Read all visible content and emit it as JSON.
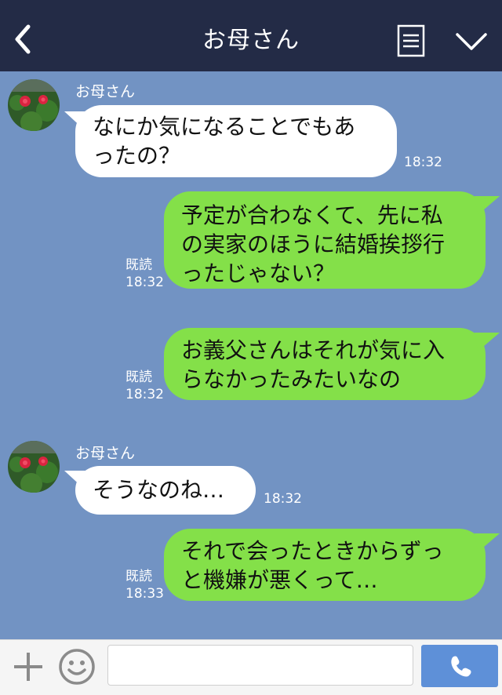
{
  "header": {
    "title": "お母さん"
  },
  "messages": [
    {
      "side": "in",
      "sender": "お母さん",
      "lines": [
        "なにか気になることでもあ",
        "ったの？"
      ],
      "time": "18:32"
    },
    {
      "side": "out",
      "lines": [
        "予定が合わなくて、先に私",
        "の実家のほうに結婚挨拶行",
        "ったじゃない？"
      ],
      "read": "既読",
      "time": "18:32"
    },
    {
      "side": "out",
      "lines": [
        "お義父さんはそれが気に入",
        "らなかったみたいなの"
      ],
      "read": "既読",
      "time": "18:32"
    },
    {
      "side": "in",
      "sender": "お母さん",
      "lines": [
        "そうなのね…"
      ],
      "time": "18:32"
    },
    {
      "side": "out",
      "lines": [
        "それで会ったときからずっ",
        "と機嫌が悪くって…"
      ],
      "read": "既読",
      "time": "18:33"
    }
  ],
  "footer": {
    "input_value": ""
  },
  "colors": {
    "header_bg": "#232b46",
    "chat_bg": "#7293c3",
    "out_bubble": "#84e049",
    "in_bubble": "#ffffff",
    "call_button": "#5e90d8"
  },
  "icons": {
    "back": "chevron-left-icon",
    "menu": "document-list-icon",
    "collapse": "chevron-down-icon",
    "add": "plus-icon",
    "emoji": "smiley-icon",
    "call": "phone-icon"
  }
}
